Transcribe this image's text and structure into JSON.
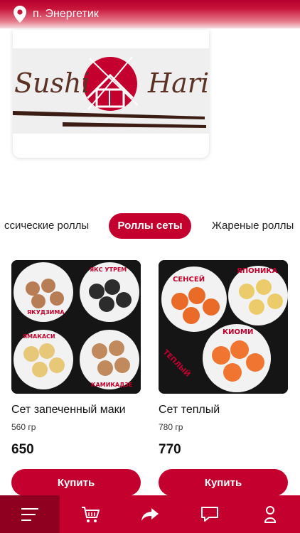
{
  "header": {
    "location": "п. Энергетик",
    "icon": "location-pin-icon"
  },
  "logo": {
    "text_left": "Sushi",
    "text_right": "Hari"
  },
  "categories": [
    {
      "label": "ссические роллы",
      "active": false
    },
    {
      "label": "Роллы сеты",
      "active": true
    },
    {
      "label": "Жареные роллы",
      "active": false
    }
  ],
  "products": [
    {
      "name": "Сет запеченный маки",
      "weight": "560 гр",
      "price": "650",
      "button": "Купить",
      "image_labels": [
        "ЯКУДЗИМА",
        "ЯКС УТРЕМ",
        "КАМИКАДЗЕ",
        "ЯМАКАСИ"
      ]
    },
    {
      "name": "Сет теплый",
      "weight": "780 гр",
      "price": "770",
      "button": "Купить",
      "image_labels": [
        "СЕНСЕЙ",
        "ЯПОНИКА",
        "КИОМИ",
        "ТЕПЛЫЙ"
      ]
    }
  ],
  "bottom_nav": [
    {
      "icon": "menu-icon",
      "active": true
    },
    {
      "icon": "cart-icon",
      "active": false
    },
    {
      "icon": "share-icon",
      "active": false
    },
    {
      "icon": "chat-icon",
      "active": false
    },
    {
      "icon": "profile-icon",
      "active": false
    }
  ],
  "colors": {
    "accent": "#c4002e",
    "active_tab": "#8f0020",
    "logo_text": "#5b3324"
  }
}
